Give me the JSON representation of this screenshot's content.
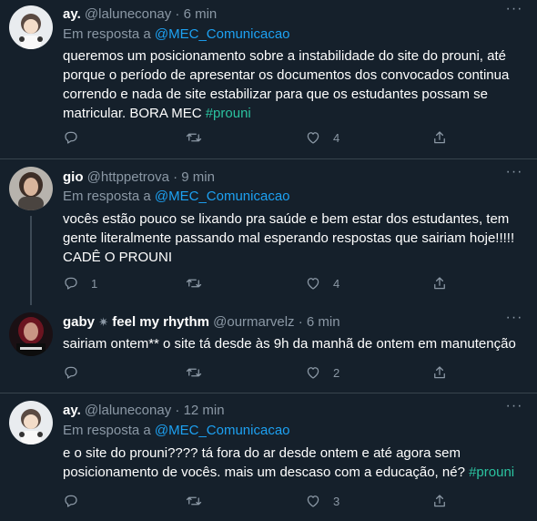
{
  "tweets": [
    {
      "display_name": "ay.",
      "handle": "@laluneconay",
      "separator": "·",
      "time": "6 min",
      "reply_prefix": "Em resposta a",
      "reply_to": "@MEC_Comunicacao",
      "body_lines": [
        "queremos um posicionamento sobre a instabilidade do site do prouni, até",
        "porque o período de apresentar os documentos dos convocados continua",
        "correndo e nada de site estabilizar para que os estudantes possam se"
      ],
      "body_last_text": "matricular. BORA MEC ",
      "hashtag": "#prouni",
      "reply_count": "",
      "retweet_count": "",
      "like_count": "4"
    },
    {
      "display_name": "gio",
      "handle": "@httppetrova",
      "separator": "·",
      "time": "9 min",
      "reply_prefix": "Em resposta a",
      "reply_to": "@MEC_Comunicacao",
      "body_lines": [
        "vocês estão pouco se lixando pra saúde e bem estar dos estudantes, tem",
        "gente literalmente passando mal esperando respostas que sairiam hoje!!!!!",
        "CADÊ O PROUNI"
      ],
      "reply_count": "1",
      "retweet_count": "",
      "like_count": "4"
    },
    {
      "display_name": "gaby",
      "display_name_suffix": "feel my rhythm",
      "handle": "@ourmarvelz",
      "separator": "·",
      "time": "6 min",
      "body_lines": [
        "sairiam ontem** o site tá desde às 9h da manhã de ontem em manutenção"
      ],
      "reply_count": "",
      "retweet_count": "",
      "like_count": "2"
    },
    {
      "display_name": "ay.",
      "handle": "@laluneconay",
      "separator": "·",
      "time": "12 min",
      "reply_prefix": "Em resposta a",
      "reply_to": "@MEC_Comunicacao",
      "body_lines": [
        "e o site do prouni???? tá fora do ar desde ontem e até agora sem"
      ],
      "body_last_text": "posicionamento de vocês. mais um descaso com a educação, né? ",
      "hashtag": "#prouni",
      "reply_count": "",
      "retweet_count": "",
      "like_count": "3"
    }
  ],
  "icons": {
    "reply": "reply-icon",
    "retweet": "retweet-icon",
    "like": "heart-icon",
    "share": "share-icon",
    "more": "more-icon"
  },
  "menu_glyph": "···",
  "colors": {
    "background": "#15202b",
    "link": "#1da1f2",
    "hashtag": "#2bc3a0",
    "muted": "#8b98a5",
    "divider": "#38444d"
  }
}
